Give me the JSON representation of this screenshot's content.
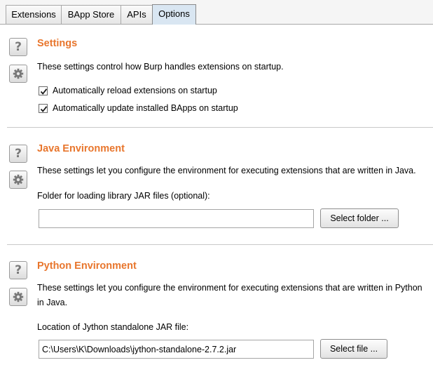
{
  "tabs": [
    {
      "label": "Extensions",
      "active": false
    },
    {
      "label": "BApp Store",
      "active": false
    },
    {
      "label": "APIs",
      "active": false
    },
    {
      "label": "Options",
      "active": true
    }
  ],
  "settings": {
    "title": "Settings",
    "description": "These settings control how Burp handles extensions on startup.",
    "checkboxes": [
      {
        "label": "Automatically reload extensions on startup",
        "checked": true
      },
      {
        "label": "Automatically update installed BApps on startup",
        "checked": true
      }
    ]
  },
  "java": {
    "title": "Java Environment",
    "description": "These settings let you configure the environment for executing extensions that are written in Java.",
    "folder_label": "Folder for loading library JAR files (optional):",
    "folder_value": "",
    "select_button": "Select folder ..."
  },
  "python": {
    "title": "Python Environment",
    "description_line1": "These settings let you configure the environment for executing extensions that are written in Python",
    "description_line2": "in Java.",
    "jar_label": "Location of Jython standalone JAR file:",
    "jar_value": "C:\\Users\\K\\Downloads\\jython-standalone-2.7.2.jar",
    "select_button": "Select file ..."
  },
  "icons": {
    "help": "help-icon",
    "settings": "gear-icon",
    "check": "check-icon"
  },
  "colors": {
    "section_title": "#e8762d",
    "active_tab": "#d9e6f2"
  }
}
